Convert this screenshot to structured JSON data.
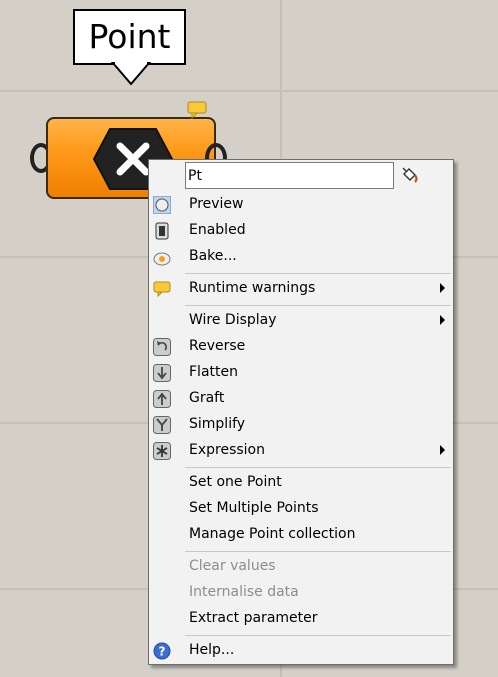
{
  "canvas": {
    "background": "#d4d0c8",
    "grid_color": "#c4c0b8"
  },
  "tooltip": {
    "text": "Point"
  },
  "component": {
    "fill": "#ff9a1a",
    "icon": "x-hexagon-icon",
    "warning_icon": "speech-bubble-icon"
  },
  "menu": {
    "name_value": "Pt",
    "paint_icon": "paint-bucket-icon",
    "items": [
      {
        "label": "Preview",
        "icon": "preview-icon"
      },
      {
        "label": "Enabled",
        "icon": "enabled-icon"
      },
      {
        "label": "Bake...",
        "icon": "bake-icon"
      },
      {
        "label": "Runtime warnings",
        "icon": "speech-bubble-icon",
        "submenu": true
      },
      {
        "label": "Wire Display",
        "submenu": true
      },
      {
        "label": "Reverse",
        "icon": "reverse-icon"
      },
      {
        "label": "Flatten",
        "icon": "flatten-icon"
      },
      {
        "label": "Graft",
        "icon": "graft-icon"
      },
      {
        "label": "Simplify",
        "icon": "simplify-icon"
      },
      {
        "label": "Expression",
        "icon": "expression-icon",
        "submenu": true
      },
      {
        "label": "Set one Point"
      },
      {
        "label": "Set Multiple Points"
      },
      {
        "label": "Manage Point collection"
      },
      {
        "label": "Clear values",
        "disabled": true
      },
      {
        "label": "Internalise data",
        "disabled": true
      },
      {
        "label": "Extract parameter"
      },
      {
        "label": "Help...",
        "icon": "help-icon"
      }
    ]
  }
}
